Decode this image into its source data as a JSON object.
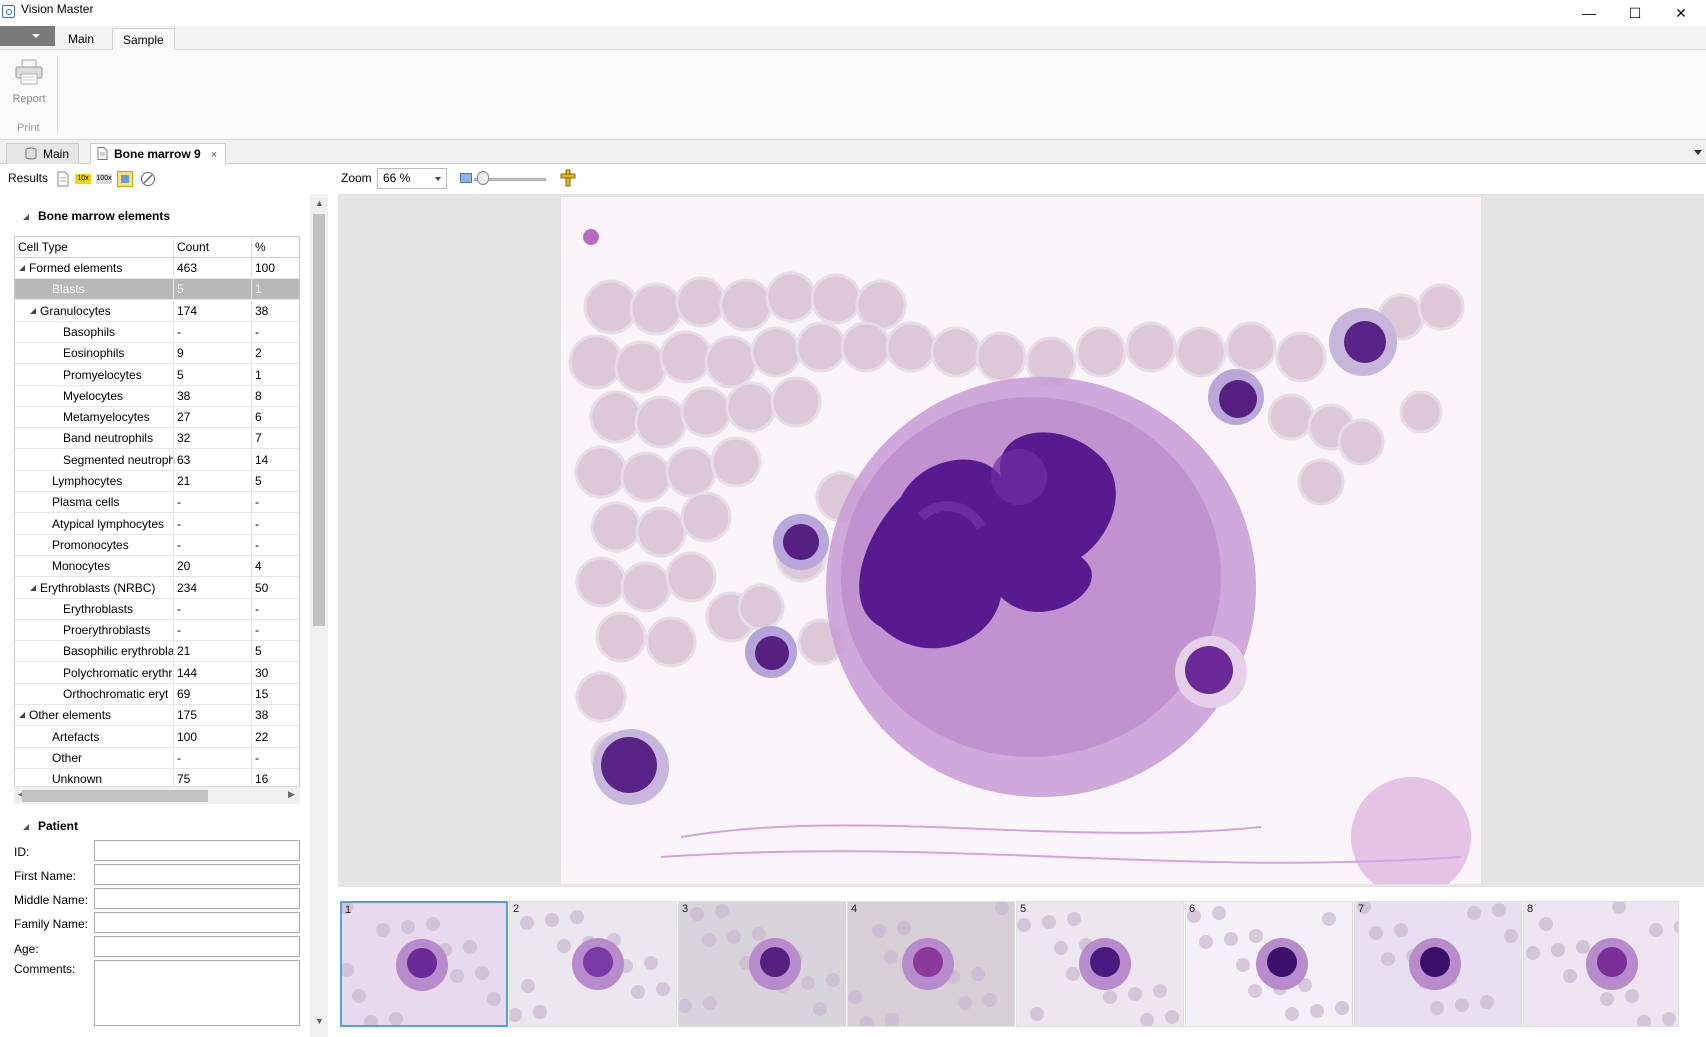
{
  "window": {
    "title": "Vision Master"
  },
  "ribbon": {
    "tabs": [
      "Main",
      "Sample"
    ],
    "report_label": "Report",
    "print_group": "Print"
  },
  "doc_tabs": {
    "main": "Main",
    "active": "Bone marrow 9",
    "close": "×"
  },
  "toolbar": {
    "results": "Results",
    "zoom_label": "Zoom",
    "zoom_value": "66 %",
    "icon_10x": "10x",
    "icon_100x": "100x",
    "zoom_slider_fraction": 0.12
  },
  "bone_marrow": {
    "title": "Bone marrow elements",
    "columns": [
      "Cell Type",
      "Count",
      "%"
    ],
    "rows": [
      {
        "name": "Formed elements",
        "count": "463",
        "pct": "100"
      },
      {
        "name": "Blasts",
        "count": "5",
        "pct": "1"
      },
      {
        "name": "Granulocytes",
        "count": "174",
        "pct": "38"
      },
      {
        "name": "Basophils",
        "count": "-",
        "pct": "-"
      },
      {
        "name": "Eosinophils",
        "count": "9",
        "pct": "2"
      },
      {
        "name": "Promyelocytes",
        "count": "5",
        "pct": "1"
      },
      {
        "name": "Myelocytes",
        "count": "38",
        "pct": "8"
      },
      {
        "name": "Metamyelocytes",
        "count": "27",
        "pct": "6"
      },
      {
        "name": "Band neutrophils",
        "count": "32",
        "pct": "7"
      },
      {
        "name": "Segmented neutroph",
        "count": "63",
        "pct": "14"
      },
      {
        "name": "Lymphocytes",
        "count": "21",
        "pct": "5"
      },
      {
        "name": "Plasma cells",
        "count": "-",
        "pct": "-"
      },
      {
        "name": "Atypical lymphocytes",
        "count": "-",
        "pct": "-"
      },
      {
        "name": "Promonocytes",
        "count": "-",
        "pct": "-"
      },
      {
        "name": "Monocytes",
        "count": "20",
        "pct": "4"
      },
      {
        "name": "Erythroblasts (NRBC)",
        "count": "234",
        "pct": "50"
      },
      {
        "name": "Erythroblasts",
        "count": "-",
        "pct": "-"
      },
      {
        "name": "Proerythroblasts",
        "count": "-",
        "pct": "-"
      },
      {
        "name": "Basophilic erythrobla",
        "count": "21",
        "pct": "5"
      },
      {
        "name": "Polychromatic erythr",
        "count": "144",
        "pct": "30"
      },
      {
        "name": "Orthochromatic eryt",
        "count": "69",
        "pct": "15"
      },
      {
        "name": "Other elements",
        "count": "175",
        "pct": "38"
      },
      {
        "name": "Artefacts",
        "count": "100",
        "pct": "22"
      },
      {
        "name": "Other",
        "count": "-",
        "pct": "-"
      },
      {
        "name": "Unknown",
        "count": "75",
        "pct": "16"
      }
    ]
  },
  "patient": {
    "title": "Patient",
    "id": "ID:",
    "first_name": "First Name:",
    "middle_name": "Middle Name:",
    "family_name": "Family Name:",
    "age": "Age:",
    "comments": "Comments:"
  },
  "thumbnails": [
    "1",
    "2",
    "3",
    "4",
    "5",
    "6",
    "7",
    "8"
  ]
}
